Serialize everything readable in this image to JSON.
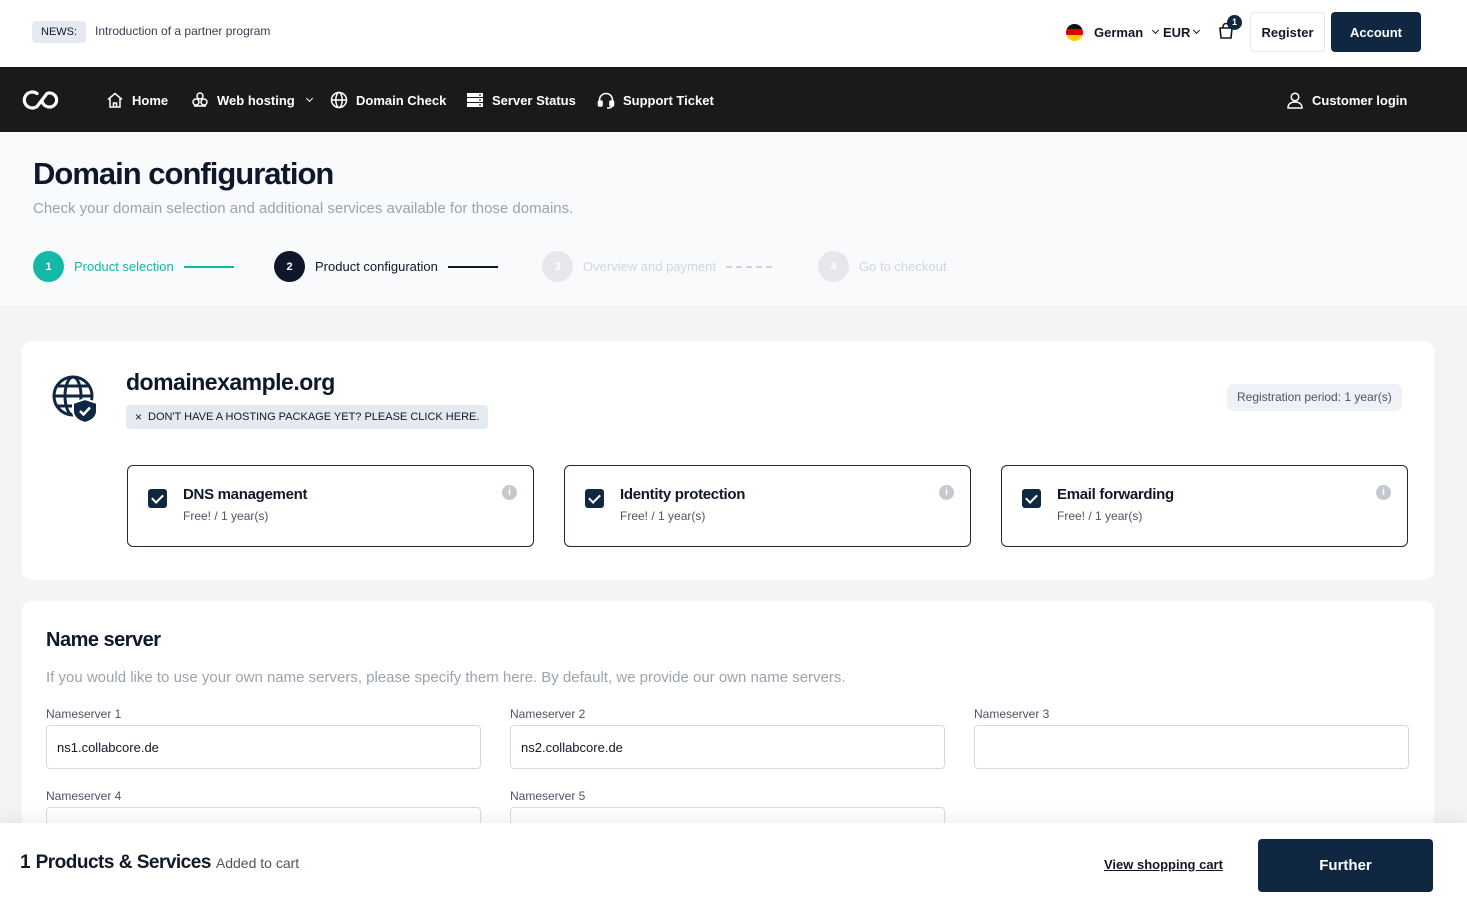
{
  "topbar": {
    "news_badge": "NEWS:",
    "news_text": "Introduction of a partner program",
    "language": "German",
    "currency": "EUR",
    "cart_count": "1",
    "register_label": "Register",
    "account_label": "Account"
  },
  "nav": {
    "items": [
      {
        "label": "Home",
        "icon": "home-icon"
      },
      {
        "label": "Web hosting",
        "icon": "cloud-icon"
      },
      {
        "label": "Domain Check",
        "icon": "globe-icon"
      },
      {
        "label": "Server Status",
        "icon": "server-icon"
      },
      {
        "label": "Support Ticket",
        "icon": "headset-icon"
      }
    ],
    "customer_login": "Customer login"
  },
  "header": {
    "title": "Domain configuration",
    "subtitle": "Check your domain selection and additional services available for those domains."
  },
  "steps": [
    {
      "num": "1",
      "label": "Product selection",
      "state": "done"
    },
    {
      "num": "2",
      "label": "Product configuration",
      "state": "active"
    },
    {
      "num": "3",
      "label": "Overview and payment",
      "state": "pending"
    },
    {
      "num": "4",
      "label": "Go to checkout",
      "state": "pending"
    }
  ],
  "domain": {
    "name": "domainexample.org",
    "hosting_tag": "DON'T HAVE A HOSTING PACKAGE YET? PLEASE CLICK HERE.",
    "hosting_tag_icon": "×",
    "registration_period": "Registration period: 1 year(s)",
    "services": [
      {
        "title": "DNS management",
        "price": "Free! / 1 year(s)",
        "checked": true
      },
      {
        "title": "Identity protection",
        "price": "Free! / 1 year(s)",
        "checked": true
      },
      {
        "title": "Email forwarding",
        "price": "Free! / 1 year(s)",
        "checked": true
      }
    ],
    "info_glyph": "i"
  },
  "nameserver": {
    "title": "Name server",
    "subtitle": "If you would like to use your own name servers, please specify them here. By default, we provide our own name servers.",
    "fields": [
      {
        "label": "Nameserver 1",
        "value": "ns1.collabcore.de"
      },
      {
        "label": "Nameserver 2",
        "value": "ns2.collabcore.de"
      },
      {
        "label": "Nameserver 3",
        "value": ""
      },
      {
        "label": "Nameserver 4",
        "value": ""
      },
      {
        "label": "Nameserver 5",
        "value": ""
      }
    ]
  },
  "bottom": {
    "count": "1",
    "label": "Products & Services",
    "sub": "Added to cart",
    "view_cart": "View shopping cart",
    "further": "Further"
  },
  "colors": {
    "navy": "#0f2740",
    "teal": "#14b8a6",
    "nav_bg": "#1a1a1a"
  }
}
